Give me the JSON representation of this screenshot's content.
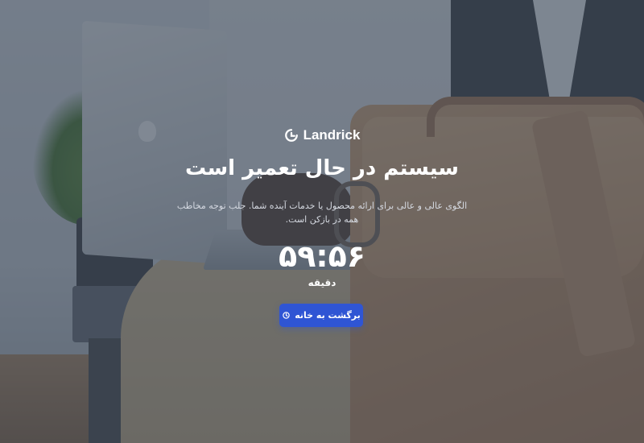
{
  "brand": {
    "name": "Landrick",
    "logo_icon": "landrick-logo-icon"
  },
  "maintenance": {
    "title": "سیستم در حال تعمیر است",
    "description": "الگوی عالی و عالی برای ارائه محصول یا خدمات آینده شما. جلب توجه مخاطب همه در بازکن است."
  },
  "countdown": {
    "value": "۵۹:۵۶",
    "unit_label": "دقیقه"
  },
  "actions": {
    "home_button_label": "برگشت به خانه",
    "home_button_icon": "history-icon",
    "accent_color": "#2f55d4"
  }
}
